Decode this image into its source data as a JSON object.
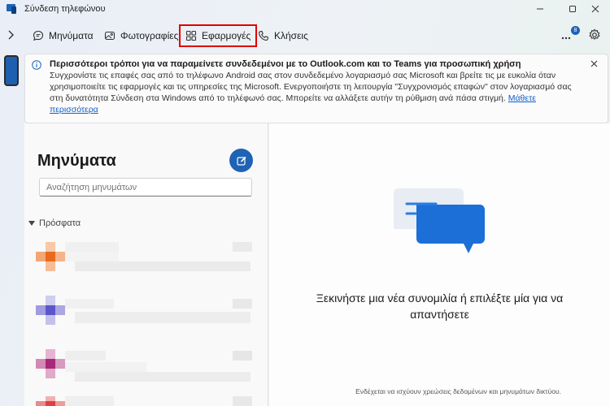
{
  "window": {
    "title": "Σύνδεση τηλεφώνου"
  },
  "nav": {
    "tabs": [
      {
        "label": "Μηνύματα",
        "icon": "chat-icon"
      },
      {
        "label": "Φωτογραφίες",
        "icon": "photos-icon"
      },
      {
        "label": "Εφαρμογές",
        "icon": "apps-icon"
      },
      {
        "label": "Κλήσεις",
        "icon": "phone-icon"
      }
    ],
    "notification_count": "8"
  },
  "banner": {
    "title": "Περισσότεροι τρόποι για να παραμείνετε συνδεδεμένοι με το Outlook.com και το Teams για προσωπική χρήση",
    "body": "Συγχρονίστε τις επαφές σας από το τηλέφωνο Android σας στον συνδεδεμένο λογαριασμό σας Microsoft και βρείτε τις με ευκολία όταν χρησιμοποιείτε τις εφαρμογές και τις υπηρεσίες της Microsoft. Ενεργοποιήστε τη λειτουργία \"Συγχρονισμός επαφών\" στον λογαριασμό σας στη δυνατότητα Σύνδεση στα Windows από το τηλέφωνό σας. Μπορείτε να αλλάξετε αυτήν τη ρύθμιση ανά πάσα στιγμή.",
    "link": "Μάθετε περισσότερα"
  },
  "messages": {
    "title": "Μηνύματα",
    "search_placeholder": "Αναζήτηση μηνυμάτων",
    "recent_label": "Πρόσφατα"
  },
  "empty_state": {
    "text": "Ξεκινήστε μια νέα συνομιλία ή επιλέξτε μία για να απαντήσετε",
    "footnote": "Ενδέχεται να ισχύουν χρεώσεις δεδομένων και μηνυμάτων δικτύου."
  },
  "colors": {
    "accent": "#1e63b5",
    "highlight_border": "#e00000",
    "avatar_1": "#e86a1e",
    "avatar_2": "#5b57c9",
    "avatar_3": "#a8287a",
    "avatar_4": "#e04040"
  }
}
